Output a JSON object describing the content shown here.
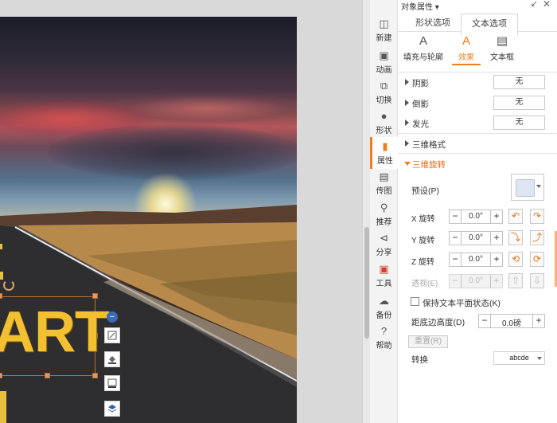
{
  "slide": {
    "text": "ART"
  },
  "panel": {
    "title": "对象属性 ▾",
    "tabs": [
      {
        "label": "形状选项"
      },
      {
        "label": "文本选项",
        "active": true
      }
    ],
    "subtabs": [
      {
        "label": "填充与轮廓",
        "icon": "text-fill-icon"
      },
      {
        "label": "效果",
        "icon": "text-effect-icon",
        "active": true
      },
      {
        "label": "文本框",
        "icon": "textbox-icon"
      }
    ],
    "effects": {
      "shadow": {
        "label": "阴影",
        "value": "无"
      },
      "reflection": {
        "label": "倒影",
        "value": "无"
      },
      "glow": {
        "label": "发光",
        "value": "无"
      },
      "format3d": {
        "label": "三维格式"
      },
      "rotation3d": {
        "label": "三维旋转"
      }
    },
    "preset_label": "预设(P)",
    "x_rotation": {
      "label": "X 旋转",
      "value": "0.0°"
    },
    "y_rotation": {
      "label": "Y 旋转",
      "value": "0.0°"
    },
    "z_rotation": {
      "label": "Z 旋转",
      "value": "0.0°"
    },
    "perspective": {
      "label": "透视(E)",
      "value": "0.0°"
    },
    "keep_flat_label": "保持文本平面状态(K)",
    "distance": {
      "label": "距底边高度(D)",
      "value": "0.0磅"
    },
    "reset_label": "重置(R)",
    "convert": {
      "label": "转换",
      "value": "abcde"
    }
  },
  "sidebar": [
    {
      "label": "新建",
      "icon": "new-icon"
    },
    {
      "label": "动画",
      "icon": "animation-icon"
    },
    {
      "label": "切换",
      "icon": "transition-icon"
    },
    {
      "label": "形状",
      "icon": "shape-icon"
    },
    {
      "label": "属性",
      "icon": "property-icon",
      "active": true
    },
    {
      "label": "传图",
      "icon": "upload-image-icon"
    },
    {
      "label": "推荐",
      "icon": "recommend-icon"
    },
    {
      "label": "分享",
      "icon": "share-icon"
    },
    {
      "label": "工具",
      "icon": "toolbox-icon"
    },
    {
      "label": "备份",
      "icon": "backup-icon"
    },
    {
      "label": "帮助",
      "icon": "help-icon"
    }
  ],
  "float_tools": [
    {
      "icon": "collapse-minus-icon"
    },
    {
      "icon": "shape-style-icon"
    },
    {
      "icon": "fill-bucket-icon"
    },
    {
      "icon": "outline-icon"
    },
    {
      "icon": "layer-stack-icon"
    },
    {
      "icon": "text-style-icon",
      "label": "字"
    }
  ],
  "colors": {
    "accent": "#f07e1e",
    "art_text": "#f2c030",
    "selection": "#c0702e"
  }
}
